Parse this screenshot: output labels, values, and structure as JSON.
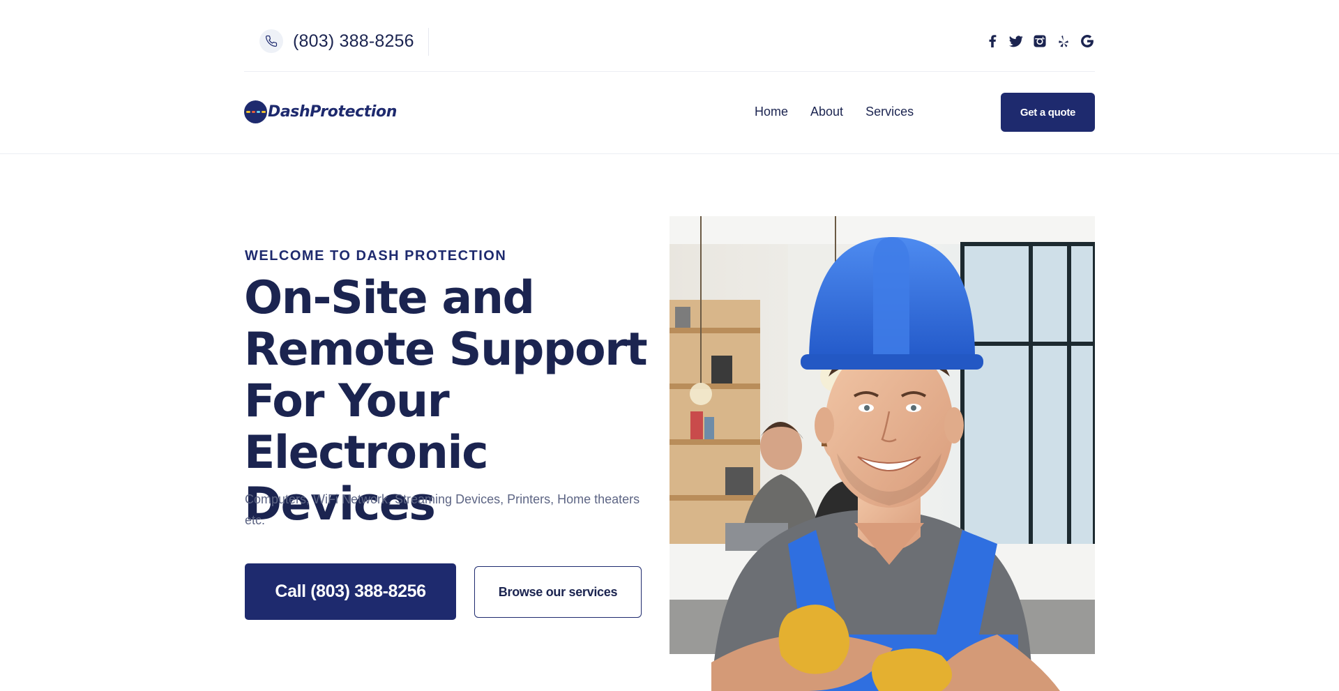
{
  "topbar": {
    "phone": "(803) 388-8256",
    "socials": [
      "facebook-icon",
      "twitter-icon",
      "instagram-icon",
      "yelp-icon",
      "google-icon"
    ]
  },
  "header": {
    "logo_text": "DashProtection",
    "nav": [
      "Home",
      "About",
      "Services"
    ],
    "quote_label": "Get a quote"
  },
  "hero": {
    "eyebrow": "WELCOME TO DASH PROTECTION",
    "title_lines": [
      "On-Site and",
      "Remote Support",
      "For Your Electronic",
      "Devices"
    ],
    "subtitle": "Computers, WiFi Network, Streaming Devices, Printers, Home theaters etc.",
    "call_label": "Call (803) 388-8256",
    "browse_label": "Browse our services"
  },
  "colors": {
    "brand_navy": "#1e2a6e",
    "heading": "#1b2450",
    "body_text": "#5d6584",
    "helmet_blue": "#2f6fe0"
  }
}
